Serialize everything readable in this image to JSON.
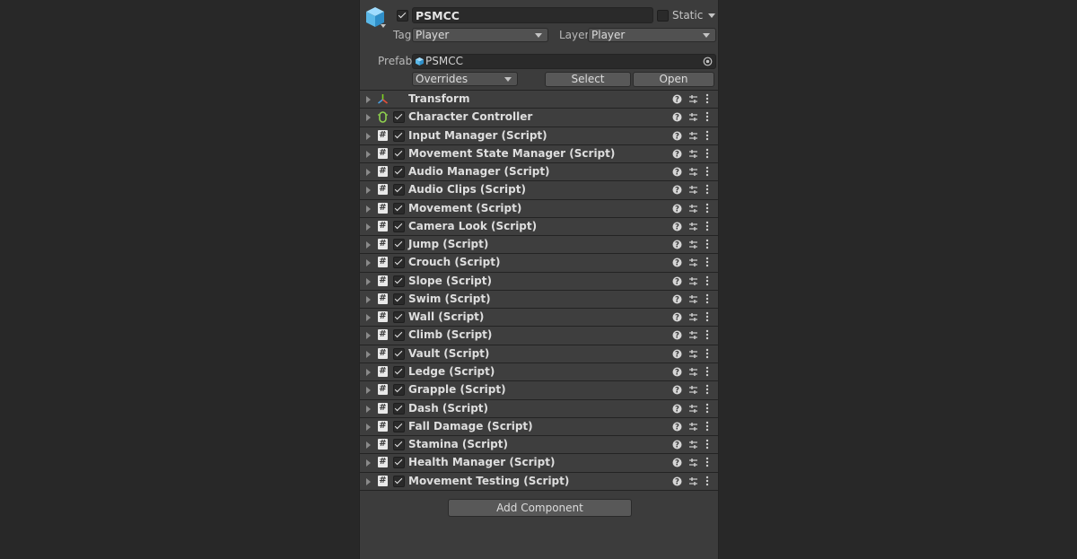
{
  "gameobject": {
    "name": "PSMCC",
    "active": true,
    "static_label": "Static",
    "static_checked": false,
    "tag_label": "Tag",
    "tag_value": "Player",
    "layer_label": "Layer",
    "layer_value": "Player",
    "icon": "gameobject-cube-icon"
  },
  "prefab": {
    "label": "Prefab",
    "value": "PSMCC",
    "overrides_label": "Overrides",
    "select_label": "Select",
    "open_label": "Open"
  },
  "components": [
    {
      "title": "Transform",
      "icon": "transform-icon",
      "has_checkbox": false
    },
    {
      "title": "Character Controller",
      "icon": "character-controller-icon",
      "has_checkbox": true
    },
    {
      "title": "Input Manager (Script)",
      "icon": "script-icon",
      "has_checkbox": true
    },
    {
      "title": "Movement State Manager (Script)",
      "icon": "script-icon",
      "has_checkbox": true
    },
    {
      "title": "Audio Manager (Script)",
      "icon": "script-icon",
      "has_checkbox": true
    },
    {
      "title": "Audio Clips (Script)",
      "icon": "script-icon",
      "has_checkbox": true
    },
    {
      "title": "Movement (Script)",
      "icon": "script-icon",
      "has_checkbox": true
    },
    {
      "title": "Camera Look (Script)",
      "icon": "script-icon",
      "has_checkbox": true
    },
    {
      "title": "Jump (Script)",
      "icon": "script-icon",
      "has_checkbox": true
    },
    {
      "title": "Crouch (Script)",
      "icon": "script-icon",
      "has_checkbox": true
    },
    {
      "title": "Slope (Script)",
      "icon": "script-icon",
      "has_checkbox": true
    },
    {
      "title": "Swim (Script)",
      "icon": "script-icon",
      "has_checkbox": true
    },
    {
      "title": "Wall (Script)",
      "icon": "script-icon",
      "has_checkbox": true
    },
    {
      "title": "Climb (Script)",
      "icon": "script-icon",
      "has_checkbox": true
    },
    {
      "title": "Vault (Script)",
      "icon": "script-icon",
      "has_checkbox": true
    },
    {
      "title": "Ledge (Script)",
      "icon": "script-icon",
      "has_checkbox": true
    },
    {
      "title": "Grapple (Script)",
      "icon": "script-icon",
      "has_checkbox": true
    },
    {
      "title": "Dash (Script)",
      "icon": "script-icon",
      "has_checkbox": true
    },
    {
      "title": "Fall Damage (Script)",
      "icon": "script-icon",
      "has_checkbox": true
    },
    {
      "title": "Stamina (Script)",
      "icon": "script-icon",
      "has_checkbox": true
    },
    {
      "title": "Health Manager (Script)",
      "icon": "script-icon",
      "has_checkbox": true
    },
    {
      "title": "Movement Testing (Script)",
      "icon": "script-icon",
      "has_checkbox": true
    }
  ],
  "add_component_label": "Add Component",
  "colors": {
    "panel_bg": "#3c3c3c",
    "outer_bg": "#282828",
    "cube_blue": "#5ab8e8",
    "controller_green": "#8fd14f"
  }
}
